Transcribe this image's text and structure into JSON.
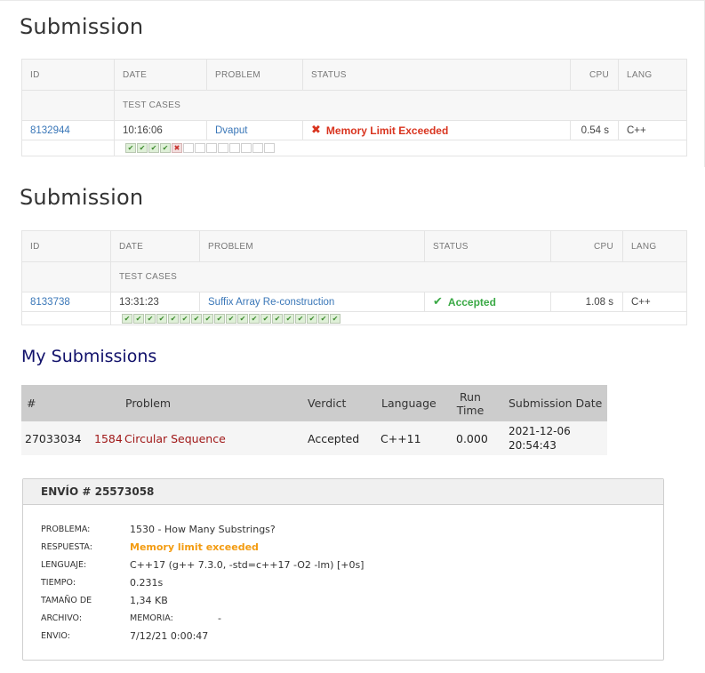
{
  "panel1": {
    "title": "Submission",
    "headers": {
      "id": "ID",
      "date": "DATE",
      "problem": "PROBLEM",
      "status": "STATUS",
      "cpu": "CPU",
      "lang": "LANG",
      "test_cases": "TEST CASES"
    },
    "row": {
      "id": "8132944",
      "date": "10:16:06",
      "problem": "Dvaput",
      "status": "Memory Limit Exceeded",
      "cpu": "0.54 s",
      "lang": "C++"
    },
    "test_cases": [
      "ok",
      "ok",
      "ok",
      "ok",
      "fail",
      "empty",
      "empty",
      "empty",
      "empty",
      "empty",
      "empty",
      "empty",
      "empty"
    ]
  },
  "panel2": {
    "title": "Submission",
    "headers": {
      "id": "ID",
      "date": "DATE",
      "problem": "PROBLEM",
      "status": "STATUS",
      "cpu": "CPU",
      "lang": "LANG",
      "test_cases": "TEST CASES"
    },
    "row": {
      "id": "8133738",
      "date": "13:31:23",
      "problem": "Suffix Array Re-construction",
      "status": "Accepted",
      "cpu": "1.08 s",
      "lang": "C++"
    },
    "test_cases": [
      "ok",
      "ok",
      "ok",
      "ok",
      "ok",
      "ok",
      "ok",
      "ok",
      "ok",
      "ok",
      "ok",
      "ok",
      "ok",
      "ok",
      "ok",
      "ok",
      "ok",
      "ok",
      "ok"
    ]
  },
  "codeforces": {
    "heading": "My Submissions",
    "headers": {
      "num": "#",
      "problem": "Problem",
      "verdict": "Verdict",
      "language": "Language",
      "runtime_1": "Run",
      "runtime_2": "Time",
      "date": "Submission Date"
    },
    "row": {
      "num": "27033034",
      "problem_num": "1584",
      "problem_name": "Circular Sequence",
      "verdict": "Accepted",
      "language": "C++11",
      "runtime": "0.000",
      "date_1": "2021-12-06",
      "date_2": "20:54:43"
    }
  },
  "envio": {
    "header": "ENVÍO # 25573058",
    "rows": [
      {
        "label": "PROBLEMA:",
        "value": "1530 - How Many Substrings?"
      },
      {
        "label": "RESPUESTA:",
        "value": "Memory limit exceeded"
      },
      {
        "label": "LENGUAJE:",
        "value": "C++17 (g++ 7.3.0, -std=c++17 -O2 -lm) [+0s]"
      },
      {
        "label": "TIEMPO:",
        "value": "0.231s"
      },
      {
        "label": "TAMAÑO DE",
        "value": "1,34 KB"
      },
      {
        "label": "ARCHIVO:",
        "value": "MEMORIA:",
        "extra": "-"
      },
      {
        "label": "ENVIO:",
        "value": "7/12/21 0:00:47"
      }
    ]
  },
  "colors": {
    "link": "#3a77b8",
    "fail": "#d9341f",
    "ok": "#3aa945",
    "cf_heading": "#10106a",
    "cf_problem": "#a01818",
    "envio_verdict": "#f39c12"
  },
  "icons": {
    "status_fail": "cross-icon",
    "status_ok": "check-icon"
  }
}
